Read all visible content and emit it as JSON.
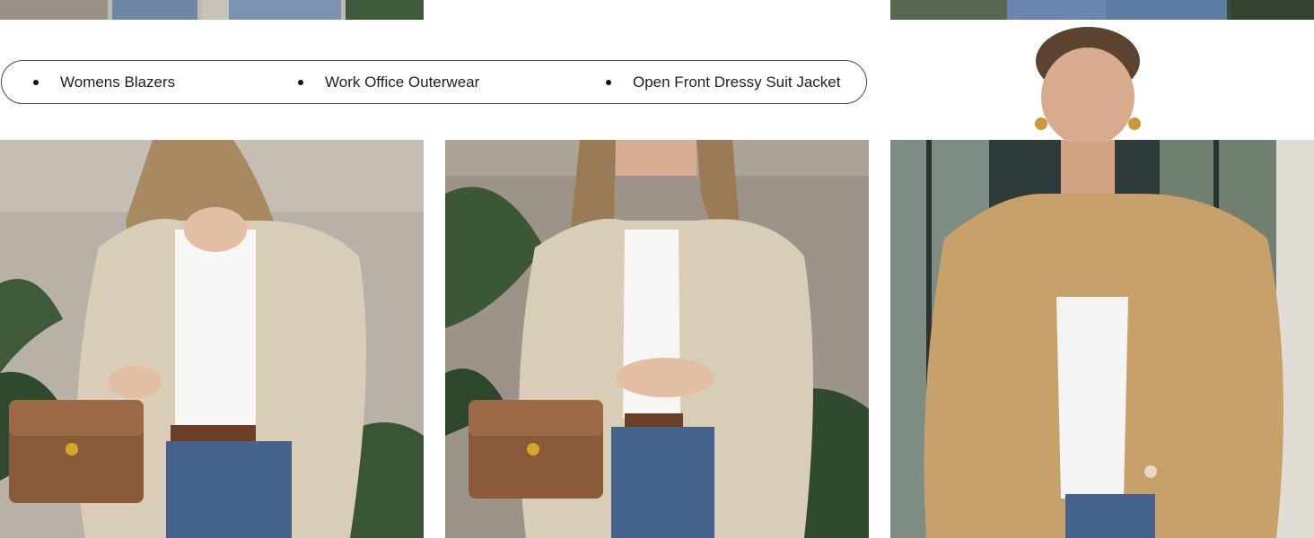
{
  "feature_tags": [
    {
      "label": "Womens Blazers"
    },
    {
      "label": "Work Office Outerwear"
    },
    {
      "label": "Open Front Dressy Suit Jacket"
    }
  ],
  "photos": [
    {
      "icon": "model-photo-cream-blazer-side"
    },
    {
      "icon": "model-photo-cream-blazer-front"
    },
    {
      "icon": "model-photo-camel-blazer-front"
    }
  ],
  "colors": {
    "cream_blazer": "#d9cdb8",
    "camel_blazer": "#c7a06a",
    "denim": "#44628c",
    "handbag": "#8b5a3a",
    "pill_border": "#4a4a4a"
  }
}
